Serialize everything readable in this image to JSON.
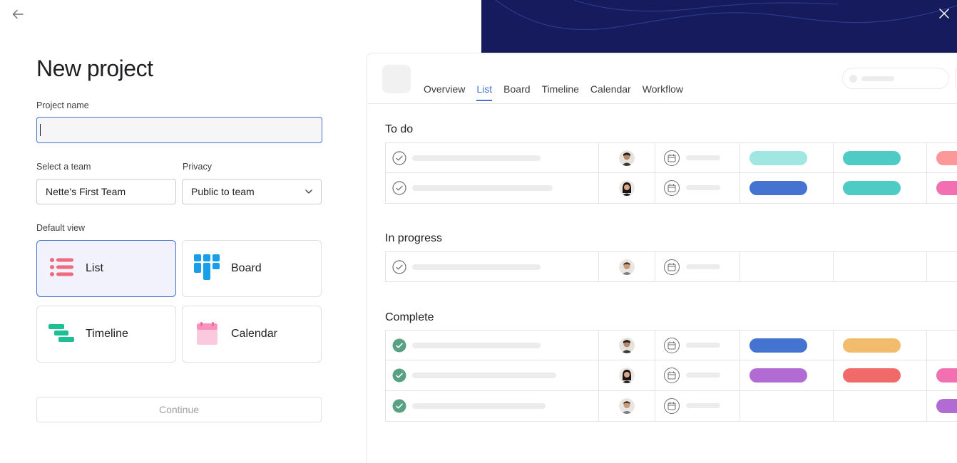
{
  "form": {
    "title": "New project",
    "project_name_label": "Project name",
    "project_name_value": "",
    "team_label": "Select a team",
    "team_value": "Nette's First Team",
    "privacy_label": "Privacy",
    "privacy_value": "Public to team",
    "default_view_label": "Default view",
    "views": [
      {
        "label": "List",
        "icon": "list-icon",
        "selected": true
      },
      {
        "label": "Board",
        "icon": "board-icon",
        "selected": false
      },
      {
        "label": "Timeline",
        "icon": "timeline-icon",
        "selected": false
      },
      {
        "label": "Calendar",
        "icon": "calendar-icon",
        "selected": false
      }
    ],
    "continue_label": "Continue"
  },
  "preview": {
    "tabs": [
      {
        "label": "Overview",
        "active": false
      },
      {
        "label": "List",
        "active": true
      },
      {
        "label": "Board",
        "active": false
      },
      {
        "label": "Timeline",
        "active": false
      },
      {
        "label": "Calendar",
        "active": false
      },
      {
        "label": "Workflow",
        "active": false
      }
    ],
    "sections": [
      {
        "title": "To do"
      },
      {
        "title": "In progress"
      },
      {
        "title": "Complete"
      }
    ]
  },
  "colors": {
    "accent": "#4573d2",
    "banner": "#151b5c",
    "teal_light": "#a0e7e1",
    "teal": "#4ecbc4",
    "blue": "#4573d2",
    "orange": "#f1bd6c",
    "purple": "#b36bd4",
    "red": "#f06a6a",
    "pink": "#f26fb2",
    "salmon": "#fc979a",
    "check_done": "#58a182"
  }
}
